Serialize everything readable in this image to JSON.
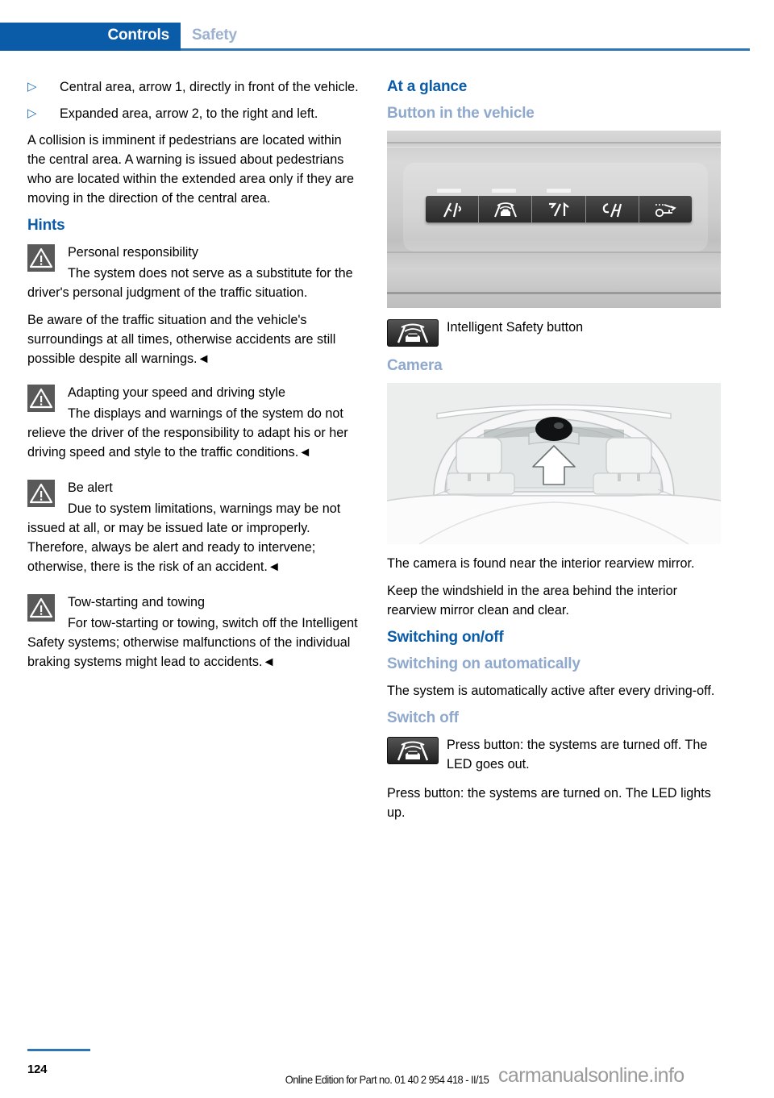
{
  "header": {
    "active_tab": "Controls",
    "inactive_tab": "Safety",
    "accent_color": "#0b5ca8",
    "muted_tab_color": "#9cb1cf"
  },
  "left_column": {
    "bullets": [
      {
        "glyph": "▷",
        "text": "Central area, arrow 1, directly in front of the vehicle."
      },
      {
        "glyph": "▷",
        "text": "Expanded area, arrow 2, to the right and left."
      }
    ],
    "intro_paragraph": "A collision is imminent if pedestrians are located within the central area. A warning is issued about pedestrians who are located within the extended area only if they are moving in the direction of the central area.",
    "hints_heading": "Hints",
    "warnings": [
      {
        "icon": "warning-triangle-icon",
        "title": "Personal responsibility",
        "body": "The system does not serve as a substitute for the driver's personal judgment of the traffic situation.",
        "body2": "Be aware of the traffic situation and the vehicle's surroundings at all times, otherwise accidents are still possible despite all warnings.◄"
      },
      {
        "icon": "warning-triangle-icon",
        "title": "Adapting your speed and driving style",
        "body": "The displays and warnings of the system do not relieve the driver of the responsibility to adapt his or her driving speed and style to the traffic conditions.◄",
        "body2": ""
      },
      {
        "icon": "warning-triangle-icon",
        "title": "Be alert",
        "body": "Due to system limitations, warnings may be not issued at all, or may be issued late or improperly. Therefore, always be alert and ready to intervene; otherwise, there is the risk of an accident.◄",
        "body2": ""
      },
      {
        "icon": "warning-triangle-icon",
        "title": "Tow-starting and towing",
        "body": "For tow-starting or towing, switch off the Intelligent Safety systems; otherwise malfunctions of the individual braking systems might lead to accidents.◄",
        "body2": ""
      }
    ]
  },
  "right_column": {
    "at_a_glance_heading": "At a glance",
    "button_in_vehicle_heading": "Button in the vehicle",
    "button_panel_figure": "vehicle-button-panel-photo",
    "intelligent_safety_caption": "Intelligent Safety button",
    "intelligent_safety_icon": "intelligent-safety-button-icon",
    "camera_heading": "Camera",
    "camera_figure": "windshield-camera-illustration",
    "camera_paragraph_1": "The camera is found near the interior rearview mirror.",
    "camera_paragraph_2": "Keep the windshield in the area behind the interior rearview mirror clean and clear.",
    "switching_heading": "Switching on/off",
    "switch_on_auto_heading": "Switching on automatically",
    "switch_on_auto_text": "The system is automatically active after every driving-off.",
    "switch_off_heading": "Switch off",
    "switch_off_icon": "intelligent-safety-button-icon",
    "switch_off_text": "Press button: the systems are turned off. The LED goes out.",
    "switch_on_text": "Press button: the systems are turned on. The LED lights up."
  },
  "footer": {
    "page_number": "124",
    "edition_note": "Online Edition for Part no. 01 40 2 954 418 - II/15",
    "watermark": "carmanualsonline.info"
  }
}
